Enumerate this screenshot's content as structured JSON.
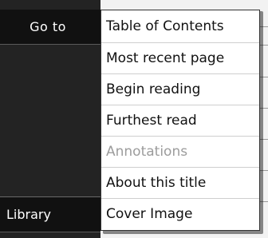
{
  "nav": {
    "goto_label": "Go to",
    "library_label": "Library"
  },
  "menu": {
    "items": [
      {
        "label": "Table of Contents",
        "enabled": true
      },
      {
        "label": "Most recent page",
        "enabled": true
      },
      {
        "label": "Begin reading",
        "enabled": true
      },
      {
        "label": "Furthest read",
        "enabled": true
      },
      {
        "label": "Annotations",
        "enabled": false
      },
      {
        "label": "About this title",
        "enabled": true
      },
      {
        "label": "Cover Image",
        "enabled": true
      }
    ]
  },
  "colors": {
    "nav_background": "#232323",
    "nav_button": "#111111",
    "menu_background": "#ffffff",
    "menu_text": "#111111",
    "menu_disabled_text": "#9c9c9c"
  }
}
